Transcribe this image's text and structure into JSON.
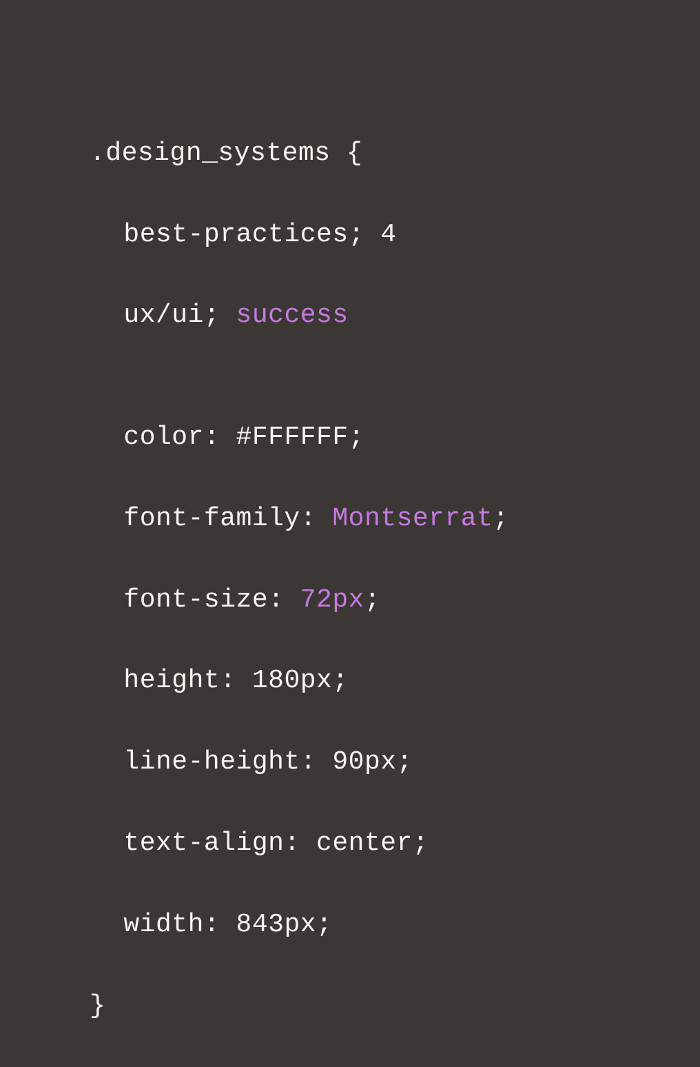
{
  "code": {
    "selector": ".design_systems {",
    "line1_prop": "best-practices;",
    "line1_val": "4",
    "line2_prop": "ux/ui;",
    "line2_val": "success",
    "blank": "",
    "line3_prop": "color:",
    "line3_val": "#FFFFFF;",
    "line4_prop": "font-family:",
    "line4_val": "Montserrat",
    "line4_semi": ";",
    "line5_prop": "font-size:",
    "line5_val": "72px",
    "line5_semi": ";",
    "line6_prop": "height:",
    "line6_val": "180px;",
    "line7_prop": "line-height:",
    "line7_val": "90px;",
    "line8_prop": "text-align:",
    "line8_val": "center;",
    "line9_prop": "width:",
    "line9_val": "843px;",
    "close": "}"
  }
}
